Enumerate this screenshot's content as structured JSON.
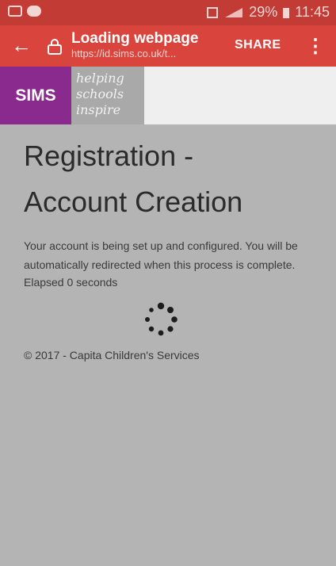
{
  "status_bar": {
    "battery": "29%",
    "time": "11:45"
  },
  "toolbar": {
    "title": "Loading webpage",
    "url": "https://id.sims.co.uk/t...",
    "share_label": "SHARE"
  },
  "banner": {
    "logo_text": "SIMS",
    "slogan_lines": [
      "helping",
      "schools",
      "inspire"
    ]
  },
  "page": {
    "title_line1": "Registration -",
    "title_line2": "Account Creation",
    "message": "Your account is being set up and configured. You will be automatically redirected when this process is complete.",
    "elapsed": "Elapsed 0 seconds",
    "footer": "© 2017 - Capita Children's Services"
  },
  "colors": {
    "status_bar": "#c23b34",
    "toolbar": "#d9443d",
    "sims_purple": "#8a2a8e",
    "page_background": "#b4b4b4"
  }
}
